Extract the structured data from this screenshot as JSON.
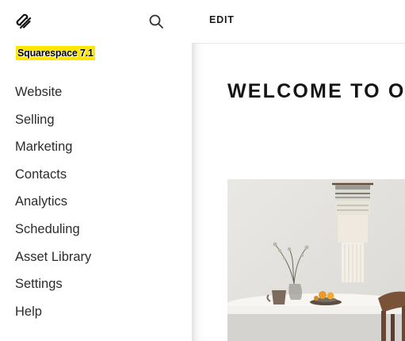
{
  "sidebar": {
    "logo_icon": "squarespace-logo-icon",
    "search_icon": "search-icon",
    "version_badge": "Squarespace 7.1",
    "badge_color": "#ffe600",
    "items": [
      {
        "label": "Website"
      },
      {
        "label": "Selling"
      },
      {
        "label": "Marketing"
      },
      {
        "label": "Contacts"
      },
      {
        "label": "Analytics"
      },
      {
        "label": "Scheduling"
      },
      {
        "label": "Asset Library"
      },
      {
        "label": "Settings"
      },
      {
        "label": "Help"
      }
    ]
  },
  "main": {
    "edit_label": "EDIT",
    "heading": "WELCOME TO OU"
  }
}
